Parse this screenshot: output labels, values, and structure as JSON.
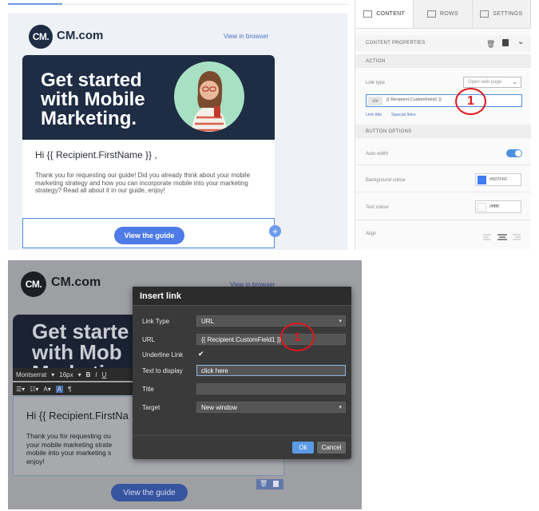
{
  "top": {
    "logo": {
      "mark": "CM.",
      "name": "CM.com"
    },
    "view_in_browser": "View in browser",
    "hero_title": "Get started\nwith Mobile\nMarketing.",
    "greeting": "Hi {{ Recipient.FirstName }} ,",
    "paragraph": "Thank you for requesting our guide! Did you already think about your mobile marketing strategy and how you can incorporate mobile into your marketing strategy? Read all about it in our guide, enjoy!",
    "cta": "View the guide",
    "side": {
      "tabs": [
        "CONTENT",
        "ROWS",
        "SETTINGS"
      ],
      "content_properties": "CONTENT PROPERTIES",
      "action": "ACTION",
      "link_type_label": "Link type",
      "link_type_value": "Open web page",
      "url_tag": "Url",
      "url_value": "{{ Recipient.CustomField1 }}",
      "link_title": "Link title",
      "special_links": "Special links",
      "button_options": "BUTTON OPTIONS",
      "auto_width": "Auto width",
      "background_colour": "Background colour",
      "background_hex": "#007FFF",
      "text_colour": "Text colour",
      "text_hex": "#ffffff",
      "align": "Align"
    },
    "marker": "1"
  },
  "bottom": {
    "logo": {
      "mark": "CM.",
      "name": "CM.com"
    },
    "view_in_browser": "View in browser",
    "hero_partial": "Get starte\nwith Mob\nMarketing.",
    "toolbar": {
      "font": "Montserrat",
      "size": "16px"
    },
    "greeting": "Hi {{ Recipient.FirstNa",
    "paragraph": "Thank you for requesting ou\nyour mobile marketing strate\nmobile into your marketing s\nenjoy!",
    "cta": "View the guide",
    "dialog": {
      "title": "Insert link",
      "link_type_label": "Link Type",
      "link_type_value": "URL",
      "url_label": "URL",
      "url_value": "{{ Recipient.CustomField1 }}",
      "underline_label": "Underline Link",
      "underline_checked": "✔",
      "display_label": "Text to display",
      "display_value": "click here",
      "title_label": "Title",
      "title_value": "",
      "target_label": "Target",
      "target_value": "New window",
      "ok": "Ok",
      "cancel": "Cancel"
    },
    "marker": "1"
  },
  "colors": {
    "navy": "#1e2c44",
    "accent": "#4f7be8",
    "marker_red": "#e0161b",
    "swatch_blue": "#007FFF"
  }
}
